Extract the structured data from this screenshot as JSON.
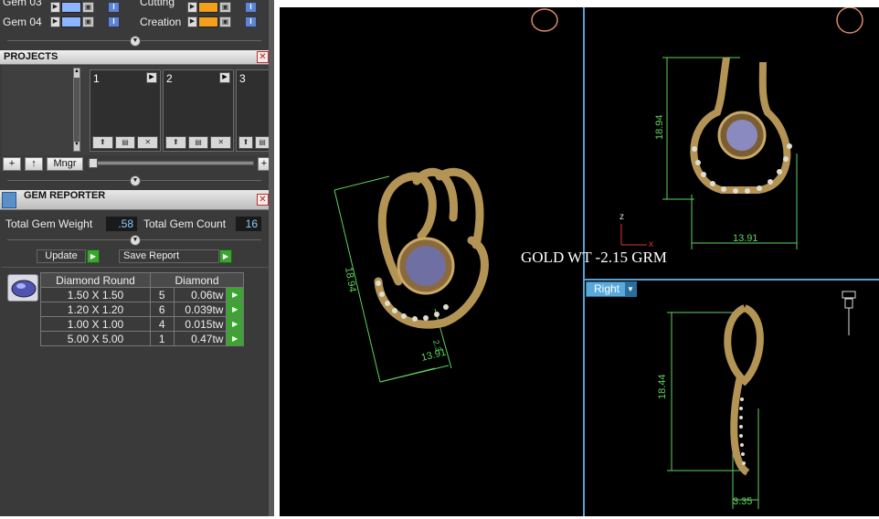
{
  "gems": [
    {
      "label": "Gem 03",
      "color": "#8db4ff"
    },
    {
      "label": "Gem 04",
      "color": "#8db4ff"
    }
  ],
  "materials": [
    {
      "label": "Cutting",
      "color": "#f4a01c"
    },
    {
      "label": "Creation",
      "color": "#f4a01c"
    }
  ],
  "projects": {
    "title": "PROJECTS",
    "slots": [
      "1",
      "2",
      "3"
    ],
    "mngr_label": "Mngr"
  },
  "gem_reporter": {
    "title": "GEM REPORTER",
    "total_weight_label": "Total Gem Weight",
    "total_weight_value": ".58",
    "total_count_label": "Total Gem Count",
    "total_count_value": "16",
    "update_label": "Update",
    "save_label": "Save Report",
    "table_headers": [
      "Diamond Round",
      "Diamond"
    ],
    "rows": [
      {
        "size": "1.50 X 1.50",
        "count": "5",
        "tw": "0.06tw"
      },
      {
        "size": "1.20 X 1.20",
        "count": "6",
        "tw": "0.039tw"
      },
      {
        "size": "1.00 X 1.00",
        "count": "4",
        "tw": "0.015tw"
      },
      {
        "size": "5.00 X 5.00",
        "count": "1",
        "tw": "0.47tw"
      }
    ]
  },
  "viewports": {
    "gold_weight_text": "GOLD WT -2.15 GRM",
    "perspective_dims": {
      "height": "18.94",
      "width": "13.91",
      "depth": "2.3"
    },
    "front_dims": {
      "height": "18.94",
      "width": "13.91"
    },
    "right_dims": {
      "height": "18.44",
      "width": "3.35"
    },
    "right_view_label": "Right",
    "axis_labels": {
      "z": "z",
      "x": "x"
    }
  },
  "colors": {
    "gold": "#b39455",
    "dimension_line": "#5fd35f",
    "viewport_divider": "#5a9fd0"
  }
}
